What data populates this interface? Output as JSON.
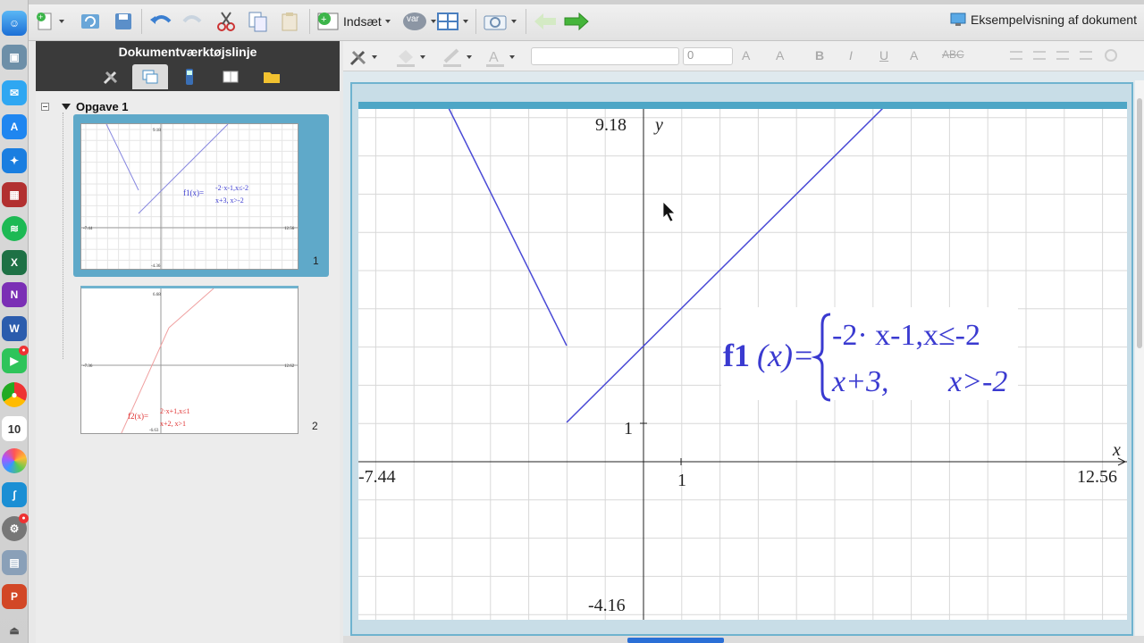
{
  "toolbar": {
    "insert_label": "Indsæt",
    "var_label": "var",
    "preview_label": "Eksempelvisning af dokument"
  },
  "format_bar": {
    "size_value": "0",
    "bold": "B",
    "italic": "I",
    "underline": "U",
    "font_size_up": "A",
    "strike": "ABC"
  },
  "sidebar": {
    "title": "Dokumentværktøjslinje",
    "task_label": "Opgave 1",
    "pages": [
      {
        "number": "1",
        "ymax": "9.18",
        "ymin": "-4.36",
        "xmin": "-7.44",
        "xmax": "12.56",
        "formula_name": "f1(x)=",
        "case1": "-2·x-1,x≤-2",
        "case2": "x+3,    x>-2"
      },
      {
        "number": "2",
        "ymax": "6.68",
        "ymin": "-6.63",
        "xmin": "-7.36",
        "xmax": "12.62",
        "formula_name": "f2(x)=",
        "case1": "2·x+1,x≤1",
        "case2": "x+2,   x>1"
      }
    ]
  },
  "graph": {
    "ymax_label": "9.18",
    "ymin_label": "-4.16",
    "xmin_label": "-7.44",
    "xmax_label": "12.56",
    "x_axis_label": "x",
    "y_axis_label": "y",
    "x_tick_label": "1",
    "y_tick_label": "1",
    "formula_name": "f1",
    "formula_var": "(x)",
    "formula_eq": "=",
    "case1": "-2· x-1,x≤-2",
    "case2_expr": "x+3,",
    "case2_cond": "x>-2",
    "line_color": "#4a4ad6"
  },
  "colors": {
    "accent": "#4ea6c6",
    "function_blue": "#3a3ad0",
    "function_red": "#e03030"
  }
}
